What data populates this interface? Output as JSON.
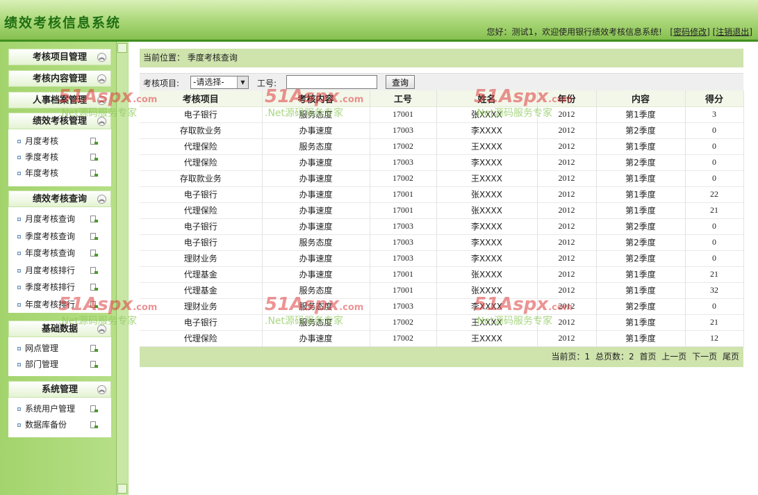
{
  "header": {
    "title": "绩效考核信息系统",
    "welcome": "您好：测试1，欢迎使用银行绩效考核信息系统!",
    "change_password": "[密码修改]",
    "logout": "[注销退出]"
  },
  "sidebar": {
    "sections": [
      {
        "title": "考核项目管理",
        "items": []
      },
      {
        "title": "考核内容管理",
        "items": []
      },
      {
        "title": "人事档案管理",
        "items": []
      },
      {
        "title": "绩效考核管理",
        "items": [
          "月度考核",
          "季度考核",
          "年度考核"
        ]
      },
      {
        "title": "绩效考核查询",
        "items": [
          "月度考核查询",
          "季度考核查询",
          "年度考核查询",
          "月度考核排行",
          "季度考核排行",
          "年度考核排行"
        ]
      },
      {
        "title": "基础数据",
        "items": [
          "网点管理",
          "部门管理"
        ]
      },
      {
        "title": "系统管理",
        "items": [
          "系统用户管理",
          "数据库备份"
        ]
      }
    ]
  },
  "location": "当前位置：  季度考核查询",
  "filter": {
    "project_label": "考核项目:",
    "project_value": "-请选择-",
    "worker_label": "工号:",
    "worker_value": "",
    "query_label": "查询"
  },
  "table": {
    "headers": [
      "考核项目",
      "考核内容",
      "工号",
      "姓名",
      "年份",
      "内容",
      "得分"
    ],
    "rows": [
      [
        "电子银行",
        "服务态度",
        "17001",
        "张XXXX",
        "2012",
        "第1季度",
        "3"
      ],
      [
        "存取款业务",
        "办事速度",
        "17003",
        "李XXXX",
        "2012",
        "第2季度",
        "0"
      ],
      [
        "代理保险",
        "服务态度",
        "17002",
        "王XXXX",
        "2012",
        "第1季度",
        "0"
      ],
      [
        "代理保险",
        "办事速度",
        "17003",
        "李XXXX",
        "2012",
        "第2季度",
        "0"
      ],
      [
        "存取款业务",
        "办事速度",
        "17002",
        "王XXXX",
        "2012",
        "第1季度",
        "0"
      ],
      [
        "电子银行",
        "办事速度",
        "17001",
        "张XXXX",
        "2012",
        "第1季度",
        "22"
      ],
      [
        "代理保险",
        "办事速度",
        "17001",
        "张XXXX",
        "2012",
        "第1季度",
        "21"
      ],
      [
        "电子银行",
        "办事速度",
        "17003",
        "李XXXX",
        "2012",
        "第2季度",
        "0"
      ],
      [
        "电子银行",
        "服务态度",
        "17003",
        "李XXXX",
        "2012",
        "第2季度",
        "0"
      ],
      [
        "理财业务",
        "办事速度",
        "17003",
        "李XXXX",
        "2012",
        "第2季度",
        "0"
      ],
      [
        "代理基金",
        "办事速度",
        "17001",
        "张XXXX",
        "2012",
        "第1季度",
        "21"
      ],
      [
        "代理基金",
        "服务态度",
        "17001",
        "张XXXX",
        "2012",
        "第1季度",
        "32"
      ],
      [
        "理财业务",
        "服务态度",
        "17003",
        "李XXXX",
        "2012",
        "第2季度",
        "0"
      ],
      [
        "电子银行",
        "服务态度",
        "17002",
        "王XXXX",
        "2012",
        "第1季度",
        "21"
      ],
      [
        "代理保险",
        "办事速度",
        "17002",
        "王XXXX",
        "2012",
        "第1季度",
        "12"
      ]
    ]
  },
  "pager": {
    "current_label": "当前页：",
    "current": "1",
    "total_label": "总页数：",
    "total": "2",
    "first": "首页",
    "prev": "上一页",
    "next": "下一页",
    "last": "尾页"
  },
  "watermark": {
    "logo": "51Aspx",
    "domain": ".com",
    "tagline": ".Net源码服务专家"
  },
  "colors": {
    "header_green": "#86c050",
    "title_green": "#1f6e12",
    "bar_green": "#cfe3ad"
  }
}
